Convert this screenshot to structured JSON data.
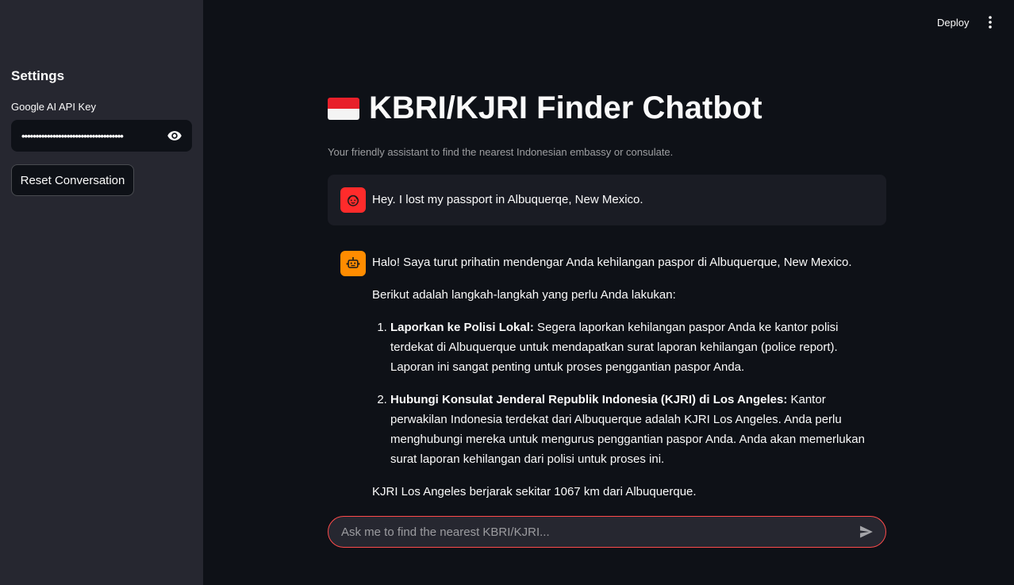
{
  "sidebar": {
    "title": "Settings",
    "api_key_label": "Google AI API Key",
    "api_key_value": "••••••••••••••••••••••••••••••••••••",
    "reset_label": "Reset Conversation"
  },
  "header": {
    "deploy_label": "Deploy"
  },
  "main": {
    "title": "KBRI/KJRI Finder Chatbot",
    "caption": "Your friendly assistant to find the nearest Indonesian embassy or consulate."
  },
  "messages": {
    "user": "Hey. I lost my passport in Albuquerqe, New Mexico.",
    "bot": {
      "intro": "Halo! Saya turut prihatin mendengar Anda kehilangan paspor di Albuquerque, New Mexico.",
      "lead": "Berikut adalah langkah-langkah yang perlu Anda lakukan:",
      "steps": [
        {
          "bold": "Laporkan ke Polisi Lokal:",
          "text": " Segera laporkan kehilangan paspor Anda ke kantor polisi terdekat di Albuquerque untuk mendapatkan surat laporan kehilangan (police report). Laporan ini sangat penting untuk proses penggantian paspor Anda."
        },
        {
          "bold": "Hubungi Konsulat Jenderal Republik Indonesia (KJRI) di Los Angeles:",
          "text": " Kantor perwakilan Indonesia terdekat dari Albuquerque adalah KJRI Los Angeles. Anda perlu menghubungi mereka untuk mengurus penggantian paspor Anda. Anda akan memerlukan surat laporan kehilangan dari polisi untuk proses ini."
        }
      ],
      "closing": "KJRI Los Angeles berjarak sekitar 1067 km dari Albuquerque."
    }
  },
  "chat_input": {
    "placeholder": "Ask me to find the nearest KBRI/KJRI..."
  },
  "colors": {
    "background": "#0e1117",
    "sidebar": "#262730",
    "accent": "#ff4b4b",
    "user_avatar": "#ff2b2b",
    "bot_avatar": "#ff8c00"
  },
  "icons": {
    "flag": "indonesia-flag-icon",
    "eye": "eye-icon",
    "kebab": "more-vertical-icon",
    "user": "user-face-icon",
    "bot": "robot-icon",
    "send": "send-icon"
  }
}
